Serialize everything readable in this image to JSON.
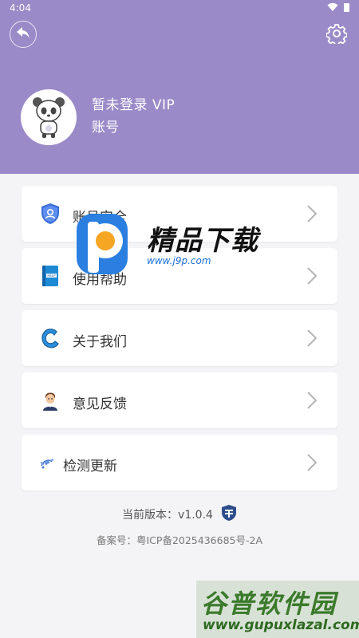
{
  "status_bar": {
    "time": "4:04"
  },
  "user": {
    "name": "暂未登录  VIP",
    "account_label": "账号"
  },
  "menu": {
    "items": [
      {
        "label": "账号安全"
      },
      {
        "label": "使用帮助"
      },
      {
        "label": "关于我们"
      },
      {
        "label": "意见反馈"
      },
      {
        "label": "检测更新"
      }
    ]
  },
  "footer": {
    "version": "当前版本：v1.0.4",
    "beian": "备案号：粤ICP备2025436685号-2A"
  },
  "watermarks": {
    "center_title": "精品下载",
    "center_url": "www.j9p.com",
    "corner_title": "谷普软件园",
    "corner_url": "www.gupuxlazal.com"
  },
  "colors": {
    "header_bg": "#9b8ac8",
    "page_bg": "#f4f4f6",
    "card_bg": "#ffffff"
  },
  "icons": {
    "back": "back-arrow-icon",
    "settings": "gear-icon",
    "avatar": "panda-avatar-icon",
    "menu": [
      "shield-user-icon",
      "help-book-icon",
      "about-c-icon",
      "feedback-person-icon",
      "update-satellite-icon"
    ],
    "chevron": "chevron-right-icon",
    "version_badge": "badge-icon"
  }
}
